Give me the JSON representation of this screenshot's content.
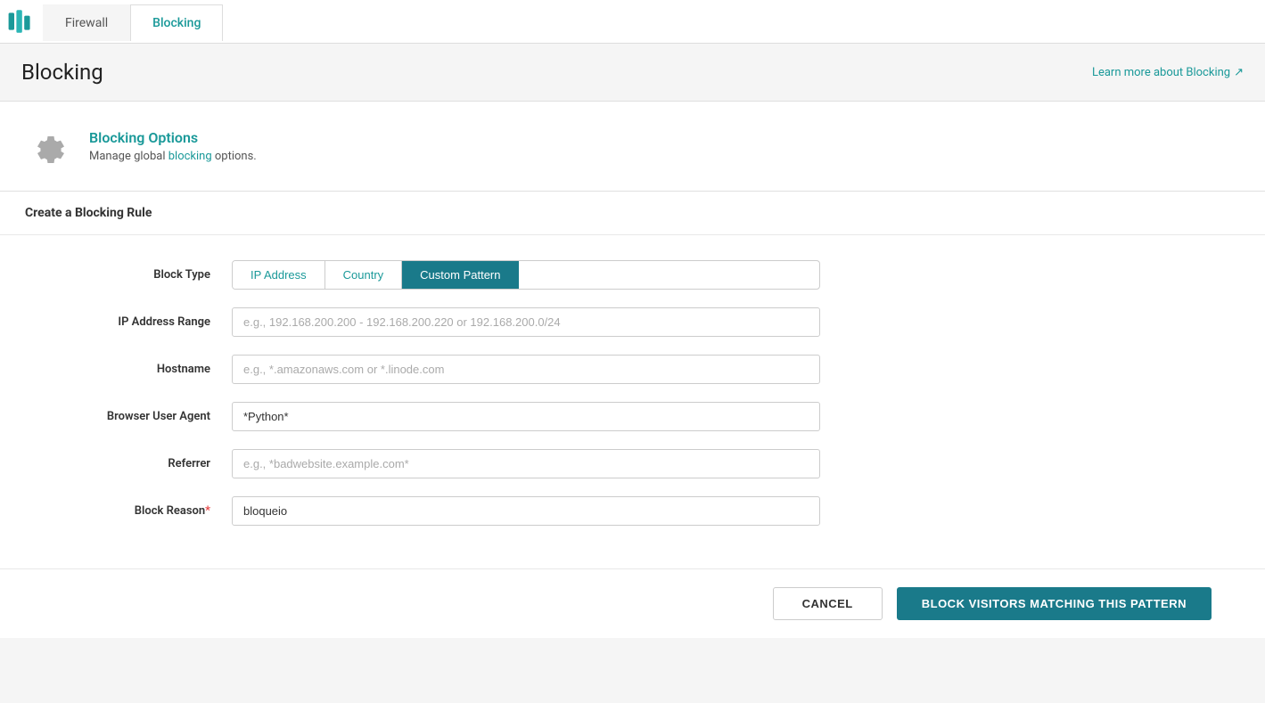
{
  "tabs": {
    "firewall": {
      "label": "Firewall",
      "active": false
    },
    "blocking": {
      "label": "Blocking",
      "active": true
    }
  },
  "page": {
    "title": "Blocking",
    "learn_more_label": "Learn more about Blocking",
    "learn_more_icon": "↗"
  },
  "blocking_options": {
    "title": "Blocking Options",
    "description_pre": "Manage global blocking options.",
    "description_link": "blocking",
    "description_post": ""
  },
  "form": {
    "section_title": "Create a Blocking Rule",
    "block_type_label": "Block Type",
    "block_types": [
      {
        "label": "IP Address",
        "active": false
      },
      {
        "label": "Country",
        "active": false
      },
      {
        "label": "Custom Pattern",
        "active": true
      }
    ],
    "ip_address_label": "IP Address Range",
    "ip_address_placeholder": "e.g., 192.168.200.200 - 192.168.200.220 or 192.168.200.0/24",
    "ip_address_value": "",
    "hostname_label": "Hostname",
    "hostname_placeholder": "e.g., *.amazonaws.com or *.linode.com",
    "hostname_value": "",
    "browser_user_agent_label": "Browser User Agent",
    "browser_user_agent_placeholder": "",
    "browser_user_agent_value": "*Python*",
    "referrer_label": "Referrer",
    "referrer_placeholder": "e.g., *badwebsite.example.com*",
    "referrer_value": "",
    "block_reason_label": "Block Reason",
    "block_reason_required": "*",
    "block_reason_placeholder": "",
    "block_reason_value": "bloqueio",
    "cancel_label": "CANCEL",
    "submit_label": "BLOCK VISITORS MATCHING THIS PATTERN"
  }
}
